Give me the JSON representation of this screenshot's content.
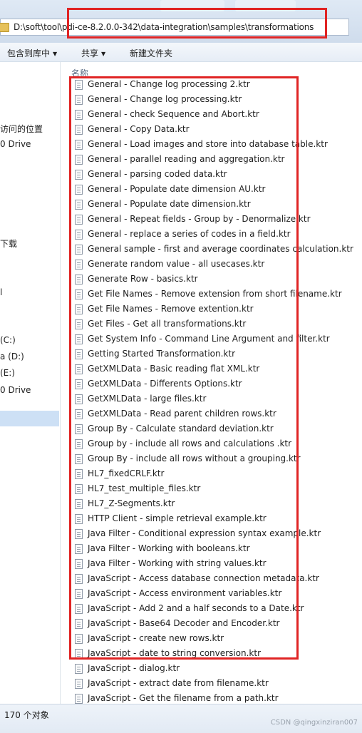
{
  "address": {
    "path": "D:\\soft\\tool\\pdi-ce-8.2.0.0-342\\data-integration\\samples\\transformations"
  },
  "toolbar": {
    "include_library": "包含到库中",
    "share": "共享",
    "new_folder": "新建文件夹"
  },
  "nav": {
    "items": [
      "访问的位置",
      "0 Drive",
      "下载",
      "l",
      "(C:)",
      "a (D:)",
      "(E:)",
      "0 Drive"
    ]
  },
  "list": {
    "column_name": "名称",
    "files": [
      "General - Change log processing 2.ktr",
      "General - Change log processing.ktr",
      "General - check Sequence and Abort.ktr",
      "General - Copy Data.ktr",
      "General - Load images and store into database table.ktr",
      "General - parallel reading and aggregation.ktr",
      "General - parsing coded data.ktr",
      "General - Populate date dimension AU.ktr",
      "General - Populate date dimension.ktr",
      "General - Repeat fields - Group by - Denormalize.ktr",
      "General - replace a series of codes in a field.ktr",
      "General sample - first and average coordinates calculation.ktr",
      "Generate random value - all usecases.ktr",
      "Generate Row - basics.ktr",
      "Get File Names - Remove extension from short filename.ktr",
      "Get File Names - Remove extention.ktr",
      "Get Files - Get all transformations.ktr",
      "Get System Info - Command Line Argument and filter.ktr",
      "Getting Started Transformation.ktr",
      "GetXMLData - Basic reading flat XML.ktr",
      "GetXMLData - Differents Options.ktr",
      "GetXMLData - large files.ktr",
      "GetXMLData - Read parent children rows.ktr",
      "Group By - Calculate standard deviation.ktr",
      "Group by - include all rows and calculations .ktr",
      "Group By - include all rows without a grouping.ktr",
      "HL7_fixedCRLF.ktr",
      "HL7_test_multiple_files.ktr",
      "HL7_Z-Segments.ktr",
      "HTTP Client - simple retrieval example.ktr",
      "Java Filter - Conditional expression syntax example.ktr",
      "Java Filter - Working with booleans.ktr",
      "Java Filter - Working with string values.ktr",
      "JavaScript - Access database connection metadata.ktr",
      "JavaScript - Access environment variables.ktr",
      "JavaScript - Add 2 and a half seconds to a Date.ktr",
      "JavaScript - Base64 Decoder and Encoder.ktr",
      "JavaScript - create new rows.ktr",
      "JavaScript - date to string conversion.ktr",
      "JavaScript - dialog.ktr",
      "JavaScript - extract date from filename.ktr",
      "JavaScript - Get the filename from a path.ktr"
    ]
  },
  "status": {
    "count": "170 个对象"
  },
  "watermark": "CSDN @qingxinziran007",
  "colors": {
    "highlight": "#e02424",
    "selected": "#cde0f5"
  }
}
